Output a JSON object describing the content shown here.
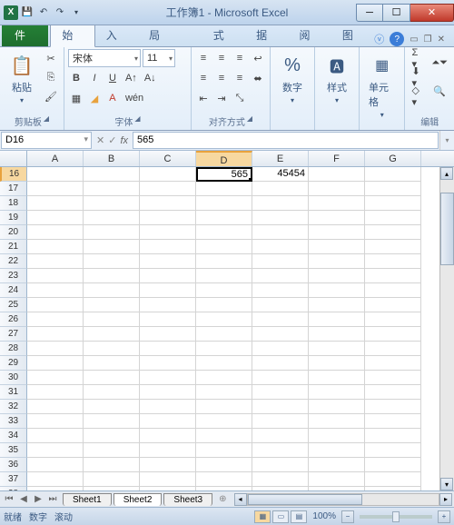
{
  "window": {
    "title": "工作簿1 - Microsoft Excel"
  },
  "tabs": {
    "file": "文件",
    "home": "开始",
    "insert": "插入",
    "layout": "页面布局",
    "formulas": "公式",
    "data": "数据",
    "review": "审阅",
    "view": "视图"
  },
  "ribbon": {
    "clipboard": {
      "label": "剪贴板",
      "paste": "粘贴"
    },
    "font": {
      "label": "字体",
      "name": "宋体",
      "size": "11",
      "bold": "B",
      "italic": "I",
      "underline": "U"
    },
    "align": {
      "label": "对齐方式"
    },
    "number": {
      "label": "数字"
    },
    "styles": {
      "label": "样式"
    },
    "cells": {
      "label": "单元格"
    },
    "editing": {
      "label": "编辑"
    }
  },
  "namebox": "D16",
  "formula": "565",
  "columns": [
    "A",
    "B",
    "C",
    "D",
    "E",
    "F",
    "G"
  ],
  "active_col_index": 3,
  "rows_start": 16,
  "rows_count": 23,
  "active_row": 16,
  "cells": {
    "D16": "565",
    "E16": "45454"
  },
  "sheets": [
    "Sheet1",
    "Sheet2",
    "Sheet3"
  ],
  "active_sheet": 1,
  "status": {
    "ready": "就绪",
    "num": "数字",
    "scroll": "滚动",
    "zoom": "100%"
  }
}
